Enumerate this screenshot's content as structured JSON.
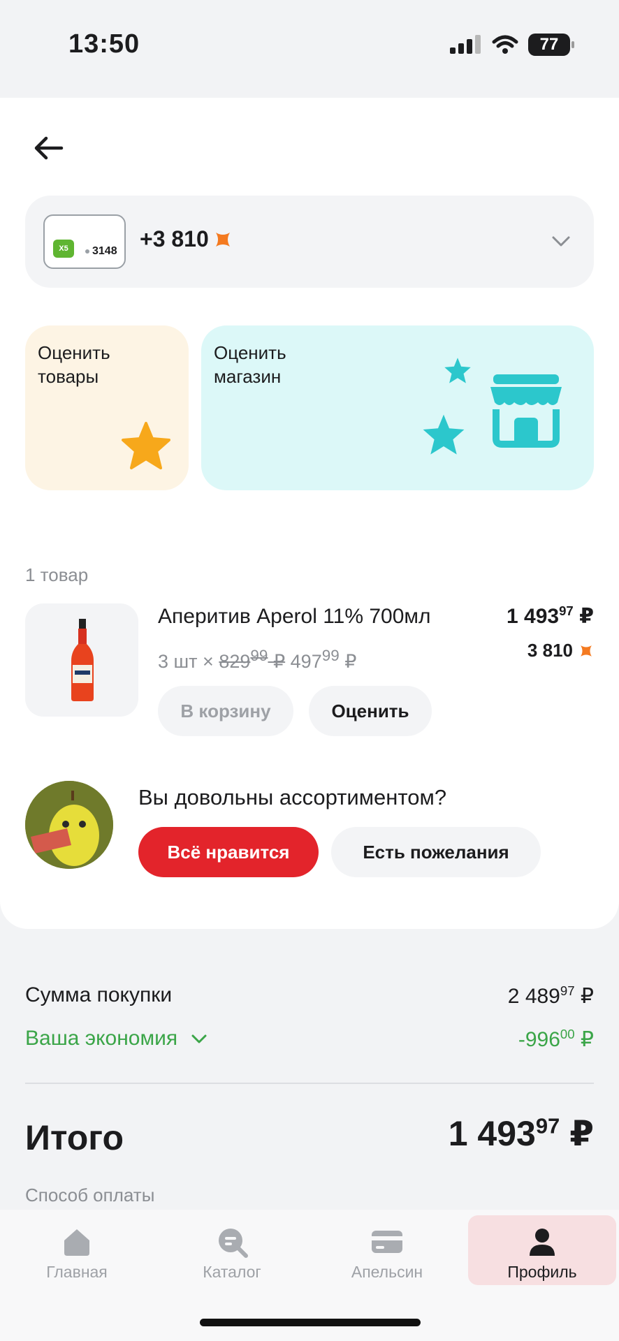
{
  "status_bar": {
    "time": "13:50",
    "battery": "77"
  },
  "loyalty": {
    "card_brand": "X5",
    "card_number": "3148",
    "points_delta": "+3 810"
  },
  "tiles": {
    "rate_goods": "Оценить\nтовары",
    "rate_shop": "Оценить\nмагазин"
  },
  "order": {
    "count_label": "1 товар",
    "items": [
      {
        "name": "Аперитив Aperol 11% 700мл",
        "qty": "3 шт ×",
        "old_price_int": "829",
        "old_price_dec": "99",
        "price_int": "497",
        "price_dec": "99",
        "total_int": "1 493",
        "total_dec": "97",
        "points": "3 810",
        "cart_label": "В корзину",
        "rate_label": "Оценить"
      }
    ]
  },
  "feedback": {
    "question": "Вы довольны ассортиментом?",
    "like_label": "Всё нравится",
    "wish_label": "Есть пожелания"
  },
  "summary": {
    "purchase_label": "Сумма покупки",
    "purchase_int": "2 489",
    "purchase_dec": "97",
    "savings_label": "Ваша экономия",
    "savings_int": "-996",
    "savings_dec": "00",
    "total_label": "Итого",
    "total_int": "1 493",
    "total_dec": "97",
    "payment_label": "Способ оплаты",
    "currency": "₽"
  },
  "tabs": [
    {
      "label": "Главная",
      "icon": "home-icon",
      "active": false
    },
    {
      "label": "Каталог",
      "icon": "catalog-search-icon",
      "active": false
    },
    {
      "label": "Апельсин",
      "icon": "card-icon",
      "active": false
    },
    {
      "label": "Профиль",
      "icon": "profile-icon",
      "active": true
    }
  ],
  "colors": {
    "accent_red": "#e3242b",
    "green": "#3ba548",
    "points_orange": "#f47a20",
    "teal": "#2cc7cc",
    "star_yellow": "#f7a81b"
  }
}
